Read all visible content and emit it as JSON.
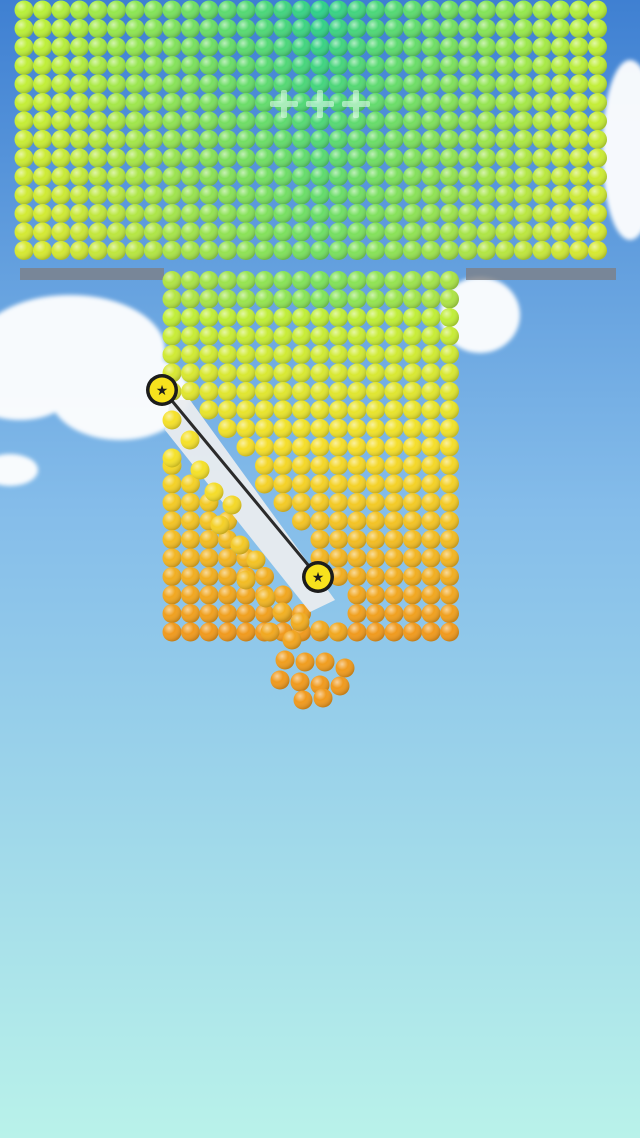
{
  "game": {
    "hud": {
      "indicator_icons": [
        "plus-icon",
        "plus-icon",
        "plus-icon"
      ],
      "indicator_text": "+++"
    },
    "colors": {
      "sky_top": "#3f80d2",
      "sky_mid": "#85bdea",
      "sky_bottom": "#b9f2ea",
      "ball_top": "#2fd08a",
      "ball_mid": "#b8f03a",
      "ball_yellow": "#f5e12a",
      "ball_bottom": "#f09a1e",
      "rope": "#2b2b2b",
      "pin_fill": "#f7e21d",
      "pin_ring": "#1c1c1c",
      "slot": "#e9ecef"
    },
    "state": {
      "falling_ball_count": 14,
      "pins": 2
    }
  }
}
